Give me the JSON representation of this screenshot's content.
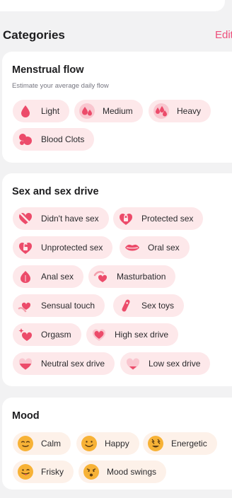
{
  "categories": {
    "title": "Categories",
    "edit_label": "Edit"
  },
  "menstrual_flow": {
    "title": "Menstrual flow",
    "subtitle": "Estimate your average daily flow",
    "items": [
      {
        "label": "Light",
        "icon": "drop-icon"
      },
      {
        "label": "Medium",
        "icon": "two-drops-icon"
      },
      {
        "label": "Heavy",
        "icon": "three-drops-icon"
      },
      {
        "label": "Blood Clots",
        "icon": "blood-clots-icon"
      }
    ]
  },
  "sex_drive": {
    "title": "Sex and sex drive",
    "items": [
      {
        "label": "Didn't have sex",
        "icon": "crossed-heart-icon"
      },
      {
        "label": "Protected sex",
        "icon": "locked-heart-icon"
      },
      {
        "label": "Unprotected sex",
        "icon": "unlocked-heart-icon"
      },
      {
        "label": "Oral sex",
        "icon": "lips-icon"
      },
      {
        "label": "Anal sex",
        "icon": "peach-icon"
      },
      {
        "label": "Masturbation",
        "icon": "hand-heart-icon"
      },
      {
        "label": "Sensual touch",
        "icon": "touch-heart-icon"
      },
      {
        "label": "Sex toys",
        "icon": "toy-icon"
      },
      {
        "label": "Orgasm",
        "icon": "sparkle-heart-icon"
      },
      {
        "label": "High sex drive",
        "icon": "full-heart-icon"
      },
      {
        "label": "Neutral sex drive",
        "icon": "half-heart-icon"
      },
      {
        "label": "Low sex drive",
        "icon": "low-heart-icon"
      }
    ]
  },
  "mood": {
    "title": "Mood",
    "items": [
      {
        "label": "Calm",
        "icon": "calm-face-icon"
      },
      {
        "label": "Happy",
        "icon": "happy-face-icon"
      },
      {
        "label": "Energetic",
        "icon": "energetic-face-icon"
      },
      {
        "label": "Frisky",
        "icon": "frisky-face-icon"
      },
      {
        "label": "Mood swings",
        "icon": "mood-swings-face-icon"
      }
    ]
  }
}
